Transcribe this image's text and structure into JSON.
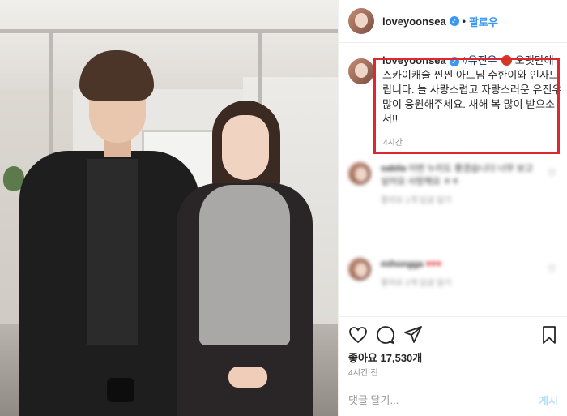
{
  "post": {
    "author": "loveyoonsea",
    "follow_label": "팔로우",
    "dot": "•"
  },
  "caption": {
    "author": "loveyoonsea",
    "hashtag": "#유진우",
    "devil_icon": "smiling-devil-emoji",
    "text": " 오랫만에 스카이캐슬 찐찐 아드님 수한이와 인사드립니다. 늘 사랑스럽고 자랑스러운 유진우 많이 응원해주세요. 새해 복 많이 받으소서!!",
    "time": "4시간"
  },
  "comments": [
    {
      "author": "sabila",
      "text": "이번 누리도 좋겠습니다 너무 보고 싶어요 사랑해요 ㅎㅎ",
      "meta": "좋아요 1개   답글 달기"
    },
    {
      "author": "mihongga",
      "text": "♥♥♥",
      "meta": "좋아요 2개   답글 달기"
    }
  ],
  "actions": {
    "likes_label": "좋아요",
    "likes_count": "17,530개",
    "post_time": "4시간 전"
  },
  "comment_bar": {
    "placeholder": "댓글 달기...",
    "post_label": "게시"
  },
  "colors": {
    "link": "#3897f0",
    "highlight_border": "#e0262e",
    "muted": "#8e8e8e"
  }
}
